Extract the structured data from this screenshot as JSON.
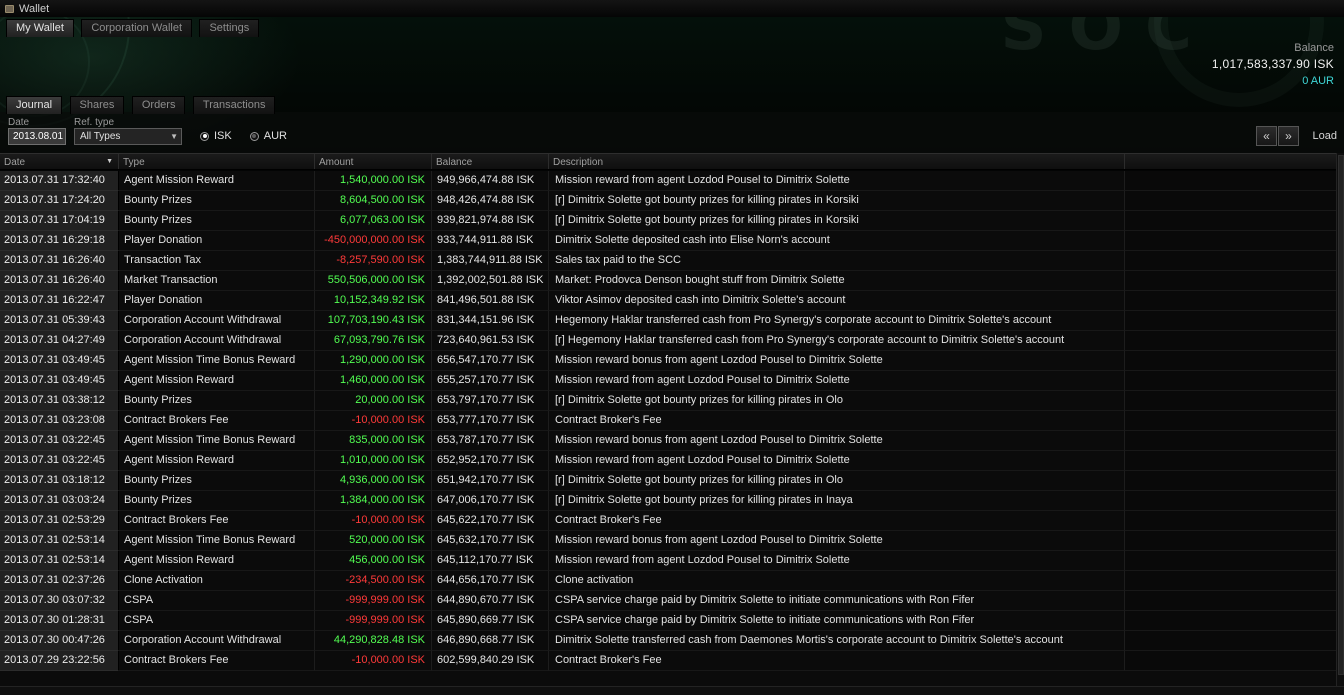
{
  "window": {
    "title": "Wallet"
  },
  "background": {
    "station_text": "SOC"
  },
  "main_tabs": [
    {
      "label": "My Wallet",
      "active": true
    },
    {
      "label": "Corporation Wallet",
      "active": false
    },
    {
      "label": "Settings",
      "active": false
    }
  ],
  "balance": {
    "label": "Balance",
    "isk": "1,017,583,337.90 ISK",
    "aur": "0 AUR"
  },
  "sub_tabs": [
    {
      "label": "Journal",
      "active": true
    },
    {
      "label": "Shares",
      "active": false
    },
    {
      "label": "Orders",
      "active": false
    },
    {
      "label": "Transactions",
      "active": false
    }
  ],
  "filters": {
    "date_label": "Date",
    "date_value": "2013.08.01",
    "ref_type_label": "Ref. type",
    "ref_type_value": "All Types",
    "currency_options": [
      {
        "label": "ISK",
        "selected": true
      },
      {
        "label": "AUR",
        "selected": false
      }
    ],
    "load_button": "Load"
  },
  "icons": {
    "sort_desc": "▼",
    "dropdown_arrow": "▼",
    "page_first": "«",
    "page_last": "»"
  },
  "colors": {
    "positive_amount": "#52ff52",
    "negative_amount": "#ff3a3a",
    "aur_text": "#3fd7d7"
  },
  "table": {
    "columns": [
      "Date",
      "Type",
      "Amount",
      "Balance",
      "Description"
    ],
    "rows": [
      {
        "date": "2013.07.31 17:32:40",
        "type": "Agent Mission Reward",
        "amount": "1,540,000.00 ISK",
        "balance": "949,966,474.88 ISK",
        "description": "Mission reward from agent Lozdod Pousel to Dimitrix Solette"
      },
      {
        "date": "2013.07.31 17:24:20",
        "type": "Bounty Prizes",
        "amount": "8,604,500.00 ISK",
        "balance": "948,426,474.88 ISK",
        "description": "[r] Dimitrix Solette got bounty prizes for killing pirates in Korsiki"
      },
      {
        "date": "2013.07.31 17:04:19",
        "type": "Bounty Prizes",
        "amount": "6,077,063.00 ISK",
        "balance": "939,821,974.88 ISK",
        "description": "[r] Dimitrix Solette got bounty prizes for killing pirates in Korsiki"
      },
      {
        "date": "2013.07.31 16:29:18",
        "type": "Player Donation",
        "amount": "-450,000,000.00 ISK",
        "balance": "933,744,911.88 ISK",
        "description": "Dimitrix Solette deposited cash into Elise Norn's account"
      },
      {
        "date": "2013.07.31 16:26:40",
        "type": "Transaction Tax",
        "amount": "-8,257,590.00 ISK",
        "balance": "1,383,744,911.88 ISK",
        "description": "Sales tax paid to the SCC"
      },
      {
        "date": "2013.07.31 16:26:40",
        "type": "Market Transaction",
        "amount": "550,506,000.00 ISK",
        "balance": "1,392,002,501.88 ISK",
        "description": "Market: Prodovca Denson bought stuff from Dimitrix Solette"
      },
      {
        "date": "2013.07.31 16:22:47",
        "type": "Player Donation",
        "amount": "10,152,349.92 ISK",
        "balance": "841,496,501.88 ISK",
        "description": "Viktor Asimov deposited cash into Dimitrix Solette's account"
      },
      {
        "date": "2013.07.31 05:39:43",
        "type": "Corporation Account Withdrawal",
        "amount": "107,703,190.43 ISK",
        "balance": "831,344,151.96 ISK",
        "description": "Hegemony Haklar transferred cash from Pro Synergy's corporate account to Dimitrix Solette's account"
      },
      {
        "date": "2013.07.31 04:27:49",
        "type": "Corporation Account Withdrawal",
        "amount": "67,093,790.76 ISK",
        "balance": "723,640,961.53 ISK",
        "description": "[r] Hegemony Haklar transferred cash from Pro Synergy's corporate account to Dimitrix Solette's account"
      },
      {
        "date": "2013.07.31 03:49:45",
        "type": "Agent Mission Time Bonus Reward",
        "amount": "1,290,000.00 ISK",
        "balance": "656,547,170.77 ISK",
        "description": "Mission reward bonus from agent Lozdod Pousel to Dimitrix Solette"
      },
      {
        "date": "2013.07.31 03:49:45",
        "type": "Agent Mission Reward",
        "amount": "1,460,000.00 ISK",
        "balance": "655,257,170.77 ISK",
        "description": "Mission reward from agent Lozdod Pousel to Dimitrix Solette"
      },
      {
        "date": "2013.07.31 03:38:12",
        "type": "Bounty Prizes",
        "amount": "20,000.00 ISK",
        "balance": "653,797,170.77 ISK",
        "description": "[r] Dimitrix Solette got bounty prizes for killing pirates in Olo"
      },
      {
        "date": "2013.07.31 03:23:08",
        "type": "Contract Brokers Fee",
        "amount": "-10,000.00 ISK",
        "balance": "653,777,170.77 ISK",
        "description": "Contract Broker's Fee"
      },
      {
        "date": "2013.07.31 03:22:45",
        "type": "Agent Mission Time Bonus Reward",
        "amount": "835,000.00 ISK",
        "balance": "653,787,170.77 ISK",
        "description": "Mission reward bonus from agent Lozdod Pousel to Dimitrix Solette"
      },
      {
        "date": "2013.07.31 03:22:45",
        "type": "Agent Mission Reward",
        "amount": "1,010,000.00 ISK",
        "balance": "652,952,170.77 ISK",
        "description": "Mission reward from agent Lozdod Pousel to Dimitrix Solette"
      },
      {
        "date": "2013.07.31 03:18:12",
        "type": "Bounty Prizes",
        "amount": "4,936,000.00 ISK",
        "balance": "651,942,170.77 ISK",
        "description": "[r] Dimitrix Solette got bounty prizes for killing pirates in Olo"
      },
      {
        "date": "2013.07.31 03:03:24",
        "type": "Bounty Prizes",
        "amount": "1,384,000.00 ISK",
        "balance": "647,006,170.77 ISK",
        "description": "[r] Dimitrix Solette got bounty prizes for killing pirates in Inaya"
      },
      {
        "date": "2013.07.31 02:53:29",
        "type": "Contract Brokers Fee",
        "amount": "-10,000.00 ISK",
        "balance": "645,622,170.77 ISK",
        "description": "Contract Broker's Fee"
      },
      {
        "date": "2013.07.31 02:53:14",
        "type": "Agent Mission Time Bonus Reward",
        "amount": "520,000.00 ISK",
        "balance": "645,632,170.77 ISK",
        "description": "Mission reward bonus from agent Lozdod Pousel to Dimitrix Solette"
      },
      {
        "date": "2013.07.31 02:53:14",
        "type": "Agent Mission Reward",
        "amount": "456,000.00 ISK",
        "balance": "645,112,170.77 ISK",
        "description": "Mission reward from agent Lozdod Pousel to Dimitrix Solette"
      },
      {
        "date": "2013.07.31 02:37:26",
        "type": "Clone Activation",
        "amount": "-234,500.00 ISK",
        "balance": "644,656,170.77 ISK",
        "description": "Clone activation"
      },
      {
        "date": "2013.07.30 03:07:32",
        "type": "CSPA",
        "amount": "-999,999.00 ISK",
        "balance": "644,890,670.77 ISK",
        "description": "CSPA service charge paid by Dimitrix Solette to initiate communications with Ron Fifer"
      },
      {
        "date": "2013.07.30 01:28:31",
        "type": "CSPA",
        "amount": "-999,999.00 ISK",
        "balance": "645,890,669.77 ISK",
        "description": "CSPA service charge paid by Dimitrix Solette to initiate communications with Ron Fifer"
      },
      {
        "date": "2013.07.30 00:47:26",
        "type": "Corporation Account Withdrawal",
        "amount": "44,290,828.48 ISK",
        "balance": "646,890,668.77 ISK",
        "description": "Dimitrix Solette transferred cash from Daemones Mortis's corporate account to Dimitrix Solette's account"
      },
      {
        "date": "2013.07.29 23:22:56",
        "type": "Contract Brokers Fee",
        "amount": "-10,000.00 ISK",
        "balance": "602,599,840.29 ISK",
        "description": "Contract Broker's Fee"
      }
    ]
  }
}
